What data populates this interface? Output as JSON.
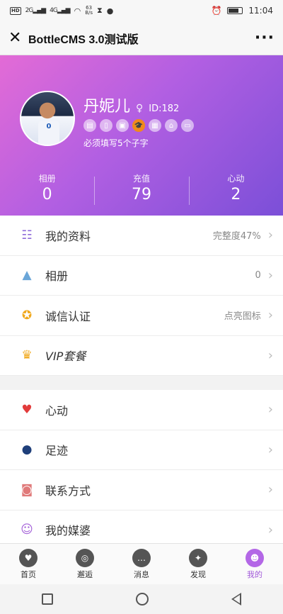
{
  "status_bar": {
    "hd": "HD",
    "net1": "2G",
    "net2": "4G",
    "speed_value": "63",
    "speed_unit": "B/s",
    "time": "11:04"
  },
  "titlebar": {
    "title": "BottleCMS 3.0测试版",
    "close_glyph": "✕",
    "more_glyph": "···"
  },
  "profile": {
    "name": "丹妮儿",
    "gender_icon": "female-icon",
    "id_text": "ID:182",
    "tip": "必须填写5个子字",
    "avatar_jersey": "0",
    "badges": [
      {
        "name": "id-card-icon",
        "glyph": "▤",
        "active": false
      },
      {
        "name": "phone-icon",
        "glyph": "▯",
        "active": false
      },
      {
        "name": "photo-icon",
        "glyph": "▣",
        "active": false
      },
      {
        "name": "education-icon",
        "glyph": "🎓",
        "active": true
      },
      {
        "name": "work-icon",
        "glyph": "▦",
        "active": false
      },
      {
        "name": "house-icon",
        "glyph": "⌂",
        "active": false
      },
      {
        "name": "car-icon",
        "glyph": "▭",
        "active": false
      }
    ],
    "stats": [
      {
        "label": "相册",
        "value": "0"
      },
      {
        "label": "充值",
        "value": "79"
      },
      {
        "label": "心动",
        "value": "2"
      }
    ]
  },
  "menu_group1": [
    {
      "name": "menu-my-profile",
      "icon": "profile-card-icon",
      "glyph": "☷",
      "color": "#8e6bd9",
      "label": "我的资料",
      "value": "完整度47%"
    },
    {
      "name": "menu-album",
      "icon": "picture-icon",
      "glyph": "▲",
      "color": "#6aa6d8",
      "label": "相册",
      "value": "0"
    },
    {
      "name": "menu-verification",
      "icon": "medal-icon",
      "glyph": "✪",
      "color": "#f0a81c",
      "label": "诚信认证",
      "value": "点亮图标"
    },
    {
      "name": "menu-vip",
      "icon": "crown-icon",
      "glyph": "♛",
      "color": "#f0a81c",
      "label": "VIP套餐",
      "value": ""
    }
  ],
  "menu_group2": [
    {
      "name": "menu-likes",
      "icon": "heartbeat-icon",
      "glyph": "♥",
      "color": "#e23b3b",
      "label": "心动",
      "value": ""
    },
    {
      "name": "menu-footprints",
      "icon": "footprint-icon",
      "glyph": "●",
      "color": "#1f3f7a",
      "label": "足迹",
      "value": ""
    },
    {
      "name": "menu-contact",
      "icon": "contact-card-icon",
      "glyph": "◙",
      "color": "#e07a7a",
      "label": "联系方式",
      "value": ""
    },
    {
      "name": "menu-matchmaker",
      "icon": "matchmaker-icon",
      "glyph": "☺",
      "color": "#a35fd8",
      "label": "我的媒婆",
      "value": ""
    }
  ],
  "tabbar": [
    {
      "name": "tab-home",
      "icon": "hearts-icon",
      "glyph": "♥",
      "label": "首页",
      "active": false
    },
    {
      "name": "tab-encounter",
      "icon": "target-icon",
      "glyph": "◎",
      "label": "邂逅",
      "active": false
    },
    {
      "name": "tab-messages",
      "icon": "chat-icon",
      "glyph": "…",
      "label": "消息",
      "active": false
    },
    {
      "name": "tab-discover",
      "icon": "compass-icon",
      "glyph": "✦",
      "label": "发现",
      "active": false
    },
    {
      "name": "tab-me",
      "icon": "user-icon",
      "glyph": "☻",
      "label": "我的",
      "active": true
    }
  ],
  "arrow_glyph": "›"
}
